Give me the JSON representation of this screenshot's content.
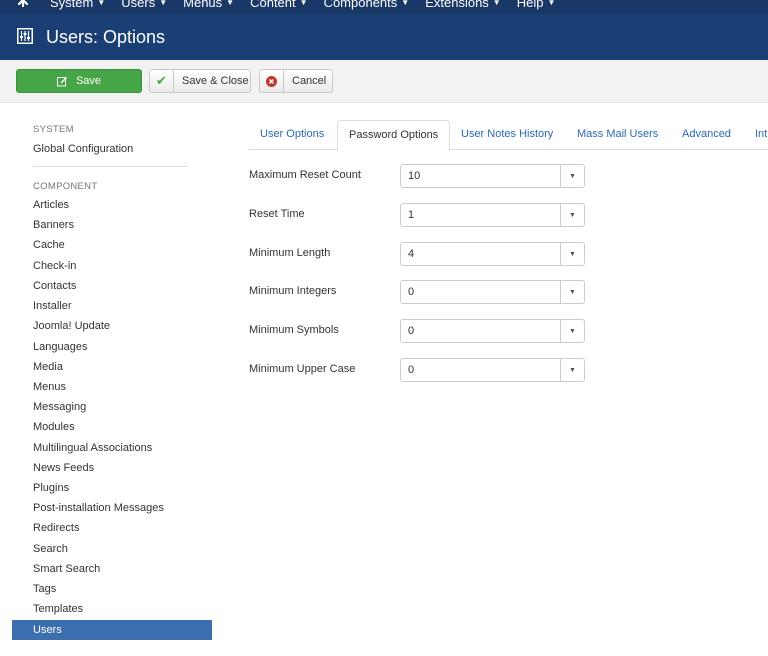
{
  "topnav": {
    "items": [
      {
        "label": "System"
      },
      {
        "label": "Users"
      },
      {
        "label": "Menus"
      },
      {
        "label": "Content"
      },
      {
        "label": "Components"
      },
      {
        "label": "Extensions"
      },
      {
        "label": "Help"
      }
    ]
  },
  "header": {
    "title": "Users: Options"
  },
  "toolbar": {
    "save_label": "Save",
    "save_close_label": "Save & Close",
    "cancel_label": "Cancel"
  },
  "sidebar": {
    "system_heading": "SYSTEM",
    "global_config": "Global Configuration",
    "component_heading": "COMPONENT",
    "items": [
      {
        "label": "Articles"
      },
      {
        "label": "Banners"
      },
      {
        "label": "Cache"
      },
      {
        "label": "Check-in"
      },
      {
        "label": "Contacts"
      },
      {
        "label": "Installer"
      },
      {
        "label": "Joomla! Update"
      },
      {
        "label": "Languages"
      },
      {
        "label": "Media"
      },
      {
        "label": "Menus"
      },
      {
        "label": "Messaging"
      },
      {
        "label": "Modules"
      },
      {
        "label": "Multilingual Associations"
      },
      {
        "label": "News Feeds"
      },
      {
        "label": "Plugins"
      },
      {
        "label": "Post-installation Messages"
      },
      {
        "label": "Redirects"
      },
      {
        "label": "Search"
      },
      {
        "label": "Smart Search"
      },
      {
        "label": "Tags"
      },
      {
        "label": "Templates"
      },
      {
        "label": "Users"
      }
    ],
    "active": "Users"
  },
  "tabs": [
    {
      "label": "User Options"
    },
    {
      "label": "Password Options"
    },
    {
      "label": "User Notes History"
    },
    {
      "label": "Mass Mail Users"
    },
    {
      "label": "Advanced"
    },
    {
      "label": "Int"
    }
  ],
  "active_tab": "Password Options",
  "form": {
    "fields": [
      {
        "label": "Maximum Reset Count",
        "value": "10"
      },
      {
        "label": "Reset Time",
        "value": "1"
      },
      {
        "label": "Minimum Length",
        "value": "4"
      },
      {
        "label": "Minimum Integers",
        "value": "0"
      },
      {
        "label": "Minimum Symbols",
        "value": "0"
      },
      {
        "label": "Minimum Upper Case",
        "value": "0"
      }
    ]
  },
  "colors": {
    "nav_bg": "#1a3867",
    "title_bg": "#1a3f75",
    "save_green": "#46a546",
    "active_blue": "#3b6fad",
    "link_blue": "#2a69b8"
  }
}
